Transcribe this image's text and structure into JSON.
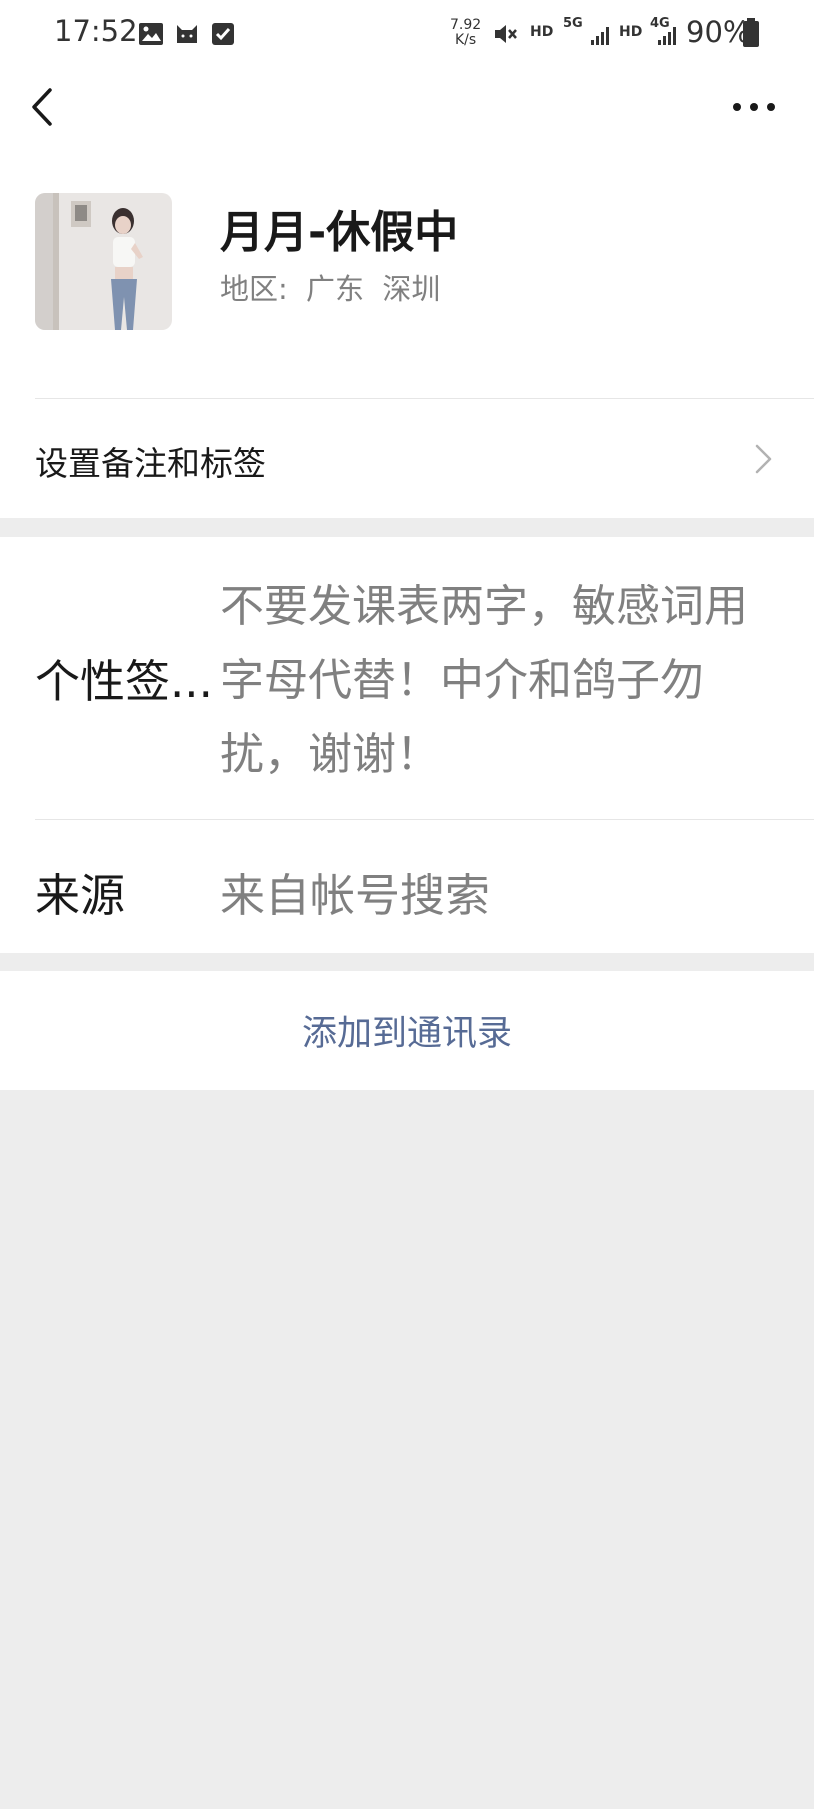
{
  "status_bar": {
    "time": "17:52",
    "net_speed_value": "7.92",
    "net_speed_unit": "K/s",
    "hd1": "HD",
    "net_5g": "5G",
    "hd2": "HD",
    "net_4g": "4G",
    "battery": "90%"
  },
  "profile": {
    "name": "月月-休假中",
    "region_label": "地区:",
    "region_value": "广东  深圳"
  },
  "rows": {
    "remark_label": "设置备注和标签",
    "signature_label": "个性签...",
    "signature_text": "不要发课表两字，敏感词用字母代替！中介和鸽子勿扰，谢谢！",
    "source_label": "来源",
    "source_value": "来自帐号搜索"
  },
  "actions": {
    "add_contact": "添加到通讯录"
  },
  "colors": {
    "link": "#576b95",
    "background": "#ededed"
  }
}
